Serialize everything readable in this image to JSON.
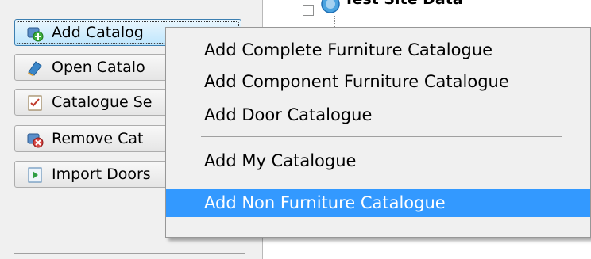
{
  "tree": {
    "item_label": "Test Site Data"
  },
  "left_panel": {
    "buttons": [
      {
        "label": "Add Catalog",
        "icon": "add-catalogue-icon"
      },
      {
        "label": "Open Catalo",
        "icon": "open-catalogue-icon"
      },
      {
        "label": "Catalogue Se",
        "icon": "catalogue-settings-icon"
      },
      {
        "label": "Remove Cat",
        "icon": "remove-catalogue-icon"
      },
      {
        "label": "Import Doors",
        "icon": "import-doors-icon"
      }
    ]
  },
  "context_menu": {
    "items": [
      {
        "label": "Add Complete Furniture Catalogue"
      },
      {
        "label": "Add Component Furniture Catalogue"
      },
      {
        "label": "Add Door Catalogue"
      },
      {
        "label": "Add My Catalogue"
      },
      {
        "label": "Add Non Furniture Catalogue"
      }
    ],
    "highlighted_index": 4
  },
  "colors": {
    "menu_highlight": "#3399ff",
    "button_active_border": "#3c7fb1"
  }
}
